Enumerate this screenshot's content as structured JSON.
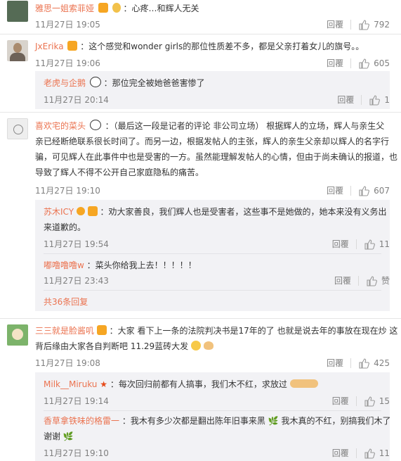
{
  "comments": [
    {
      "user": "雅思一姐索菲娅",
      "text": "：心疼…和辉人无关",
      "time": "11月27日 19:05",
      "reply_label": "回覆",
      "likes": "792"
    },
    {
      "user": "JxErika",
      "text": "：这个感觉和wonder girls的那位性质差不多，都是父亲打着女儿的旗号。。",
      "time": "11月27日 19:06",
      "reply_label": "回覆",
      "likes": "605",
      "replies": [
        {
          "user": "老虎与企鹅",
          "text": "：那位完全被她爸爸害惨了",
          "time": "11月27日 20:14",
          "reply_label": "回覆",
          "likes": "1"
        }
      ]
    },
    {
      "user": "喜欢宅的菜头",
      "text_lines": [
        "：（最后这一段是记者的评论 非公司立场） 根据辉人的立场，辉人与亲生父",
        "亲已经断绝联系很长时间了。而另一边，根据发帖人的主张，辉人的亲生父亲却以辉人的名字行",
        "骗，可见辉人在此事件中也是受害的一方。虽然能理解发帖人的心情，但由于尚未确认的报道，也",
        "导致了辉人不得不公开自己家庭隐私的痛苦。"
      ],
      "time": "11月27日 19:10",
      "reply_label": "回覆",
      "likes": "607",
      "replies": [
        {
          "user": "苏木ICY",
          "text_lines": [
            "：劝大家善良，我们辉人也是受害者，这些事不是她做的，她本来没有义务出",
            "来道歉的。"
          ],
          "time": "11月27日 19:54",
          "reply_label": "回覆",
          "likes": "11"
        },
        {
          "user": "嘟噜噜噜w",
          "text": "：菜头你给我上去！！！！！",
          "time": "11月27日 23:43",
          "reply_label": "回覆",
          "likes": "赞"
        }
      ],
      "more_label": "共36条回复"
    },
    {
      "user": "三三就是脸酱叽",
      "text_lines": [
        "：大家 看下上一条的法院判决书是17年的了 也就是说去年的事放在现在炒 这",
        "背后缘由大家各自判断吧 11.29蓝砖大发"
      ],
      "time": "11月27日 19:08",
      "reply_label": "回覆",
      "likes": "425",
      "replies": [
        {
          "user": "Milk__Miruku",
          "text": "：每次回归前都有人搞事，我们木不红，求放过",
          "time": "11月27日 19:14",
          "reply_label": "回覆",
          "likes": "15"
        },
        {
          "user": "香草拿铁味的格雷一",
          "text_lines": [
            "：我木有多少次都是翻出陈年旧事来黑",
            "我木真的不红，别搞我们木了",
            "谢谢"
          ],
          "time": "11月27日 19:10",
          "reply_label": "回覆",
          "likes": "11"
        }
      ]
    }
  ],
  "colors": {
    "username": "#eb7350",
    "meta": "#808080",
    "reply_bg": "#f2f2f5"
  }
}
